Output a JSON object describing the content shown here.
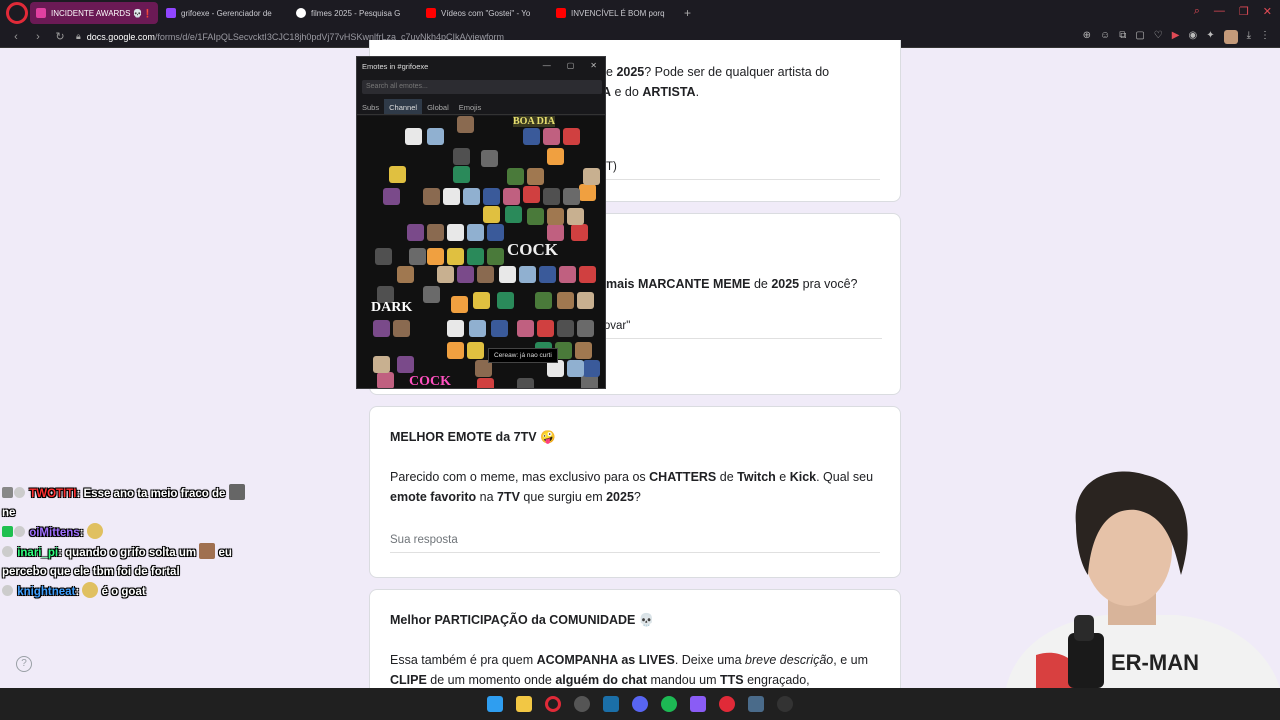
{
  "browser": {
    "tabs": [
      {
        "label": "INCIDENTE AWARDS 💀❗",
        "active": true,
        "color": "#e040a0"
      },
      {
        "label": "grifoexe - Gerenciador de",
        "active": false,
        "color": "#9146ff"
      },
      {
        "label": "filmes 2025 - Pesquisa G",
        "active": false,
        "color": "#ffffff"
      },
      {
        "label": "Vídeos com \"Gostei\" - Yo",
        "active": false,
        "color": "#ff0000"
      },
      {
        "label": "INVENCÍVEL É BOM porq",
        "active": false,
        "color": "#ff0000"
      }
    ],
    "url_host": "docs.google.com",
    "url_path": "/forms/d/e/1FAIpQLSecvcktI3CJC18jh0pdVj77vHSKwnlfrLza_c7uyNkh4pCIkA/viewform"
  },
  "form": {
    "card1": {
      "desc_frag1": "e ",
      "desc_year": "2025",
      "desc_frag2": "? Pode ser de qualquer artista do",
      "desc_frag3": "A",
      "desc_frag4": " e do ",
      "desc_artist": "ARTISTA",
      "desc_end": ".",
      "answer_frag": "T)"
    },
    "card2": {
      "desc_frag1": "mais MARCANTE MEME",
      "desc_frag2": " de ",
      "desc_year": "2025",
      "desc_frag3": " pra você?",
      "answer_frag": "rovar\""
    },
    "card3": {
      "title": "MELHOR EMOTE da 7TV 🤪",
      "p1": "Parecido com o meme, mas exclusivo para os ",
      "chatters": "CHATTERS",
      "p2": " de ",
      "twitch": "Twitch",
      "p3": " e ",
      "kick": "Kick",
      "p4": ". Qual seu ",
      "emote_favorito": "emote favorito",
      "p5": " na ",
      "sevtv": "7TV",
      "p6": " que surgiu em ",
      "year": "2025",
      "p7": "?",
      "answer_placeholder": "Sua resposta"
    },
    "card4": {
      "title": "Melhor PARTICIPAÇÃO da COMUNIDADE 💀",
      "p1": "Essa também é pra quem ",
      "acompanha": "ACOMPANHA as LIVES",
      "p2": ". Deixe uma ",
      "breve": "breve descrição",
      "p3": ", e um ",
      "clipe": "CLIPE",
      "p4": " de um momento onde ",
      "alguem": "alguém do chat",
      "p5": " mandou um ",
      "tts": "TTS",
      "p6": " engraçado,"
    }
  },
  "emotes_popup": {
    "title": "Emotes in #grifoexe",
    "search_placeholder": "Search all emotes...",
    "tabs": [
      "Subs",
      "Channel",
      "Global",
      "Emojis"
    ],
    "active_tab": "Channel",
    "tooltip": "Cereaw: já nao curti",
    "labels": {
      "boa_dia": "BOA DIA",
      "cock": "COCK",
      "dark": "DARK",
      "cock2": "COCK"
    }
  },
  "chat": [
    {
      "user": "TWOTITI",
      "user_color": "#ff3030",
      "text": "Esse ano ta meio fraco de",
      "text2": "ne"
    },
    {
      "user": "oiMittens",
      "user_color": "#a070ff",
      "text": ""
    },
    {
      "user": "inari_pi",
      "user_color": "#30ff80",
      "text": "quando o grifo solta um",
      "text2": "eu percebo que ele tbm foi de fortal"
    },
    {
      "user": "knightneat",
      "user_color": "#40a0ff",
      "text": "é o goat"
    }
  ],
  "colors": {
    "form_bg": "#f0ebf8",
    "active_tab": "#6b1a55",
    "browser_bg": "#1c1b22"
  }
}
